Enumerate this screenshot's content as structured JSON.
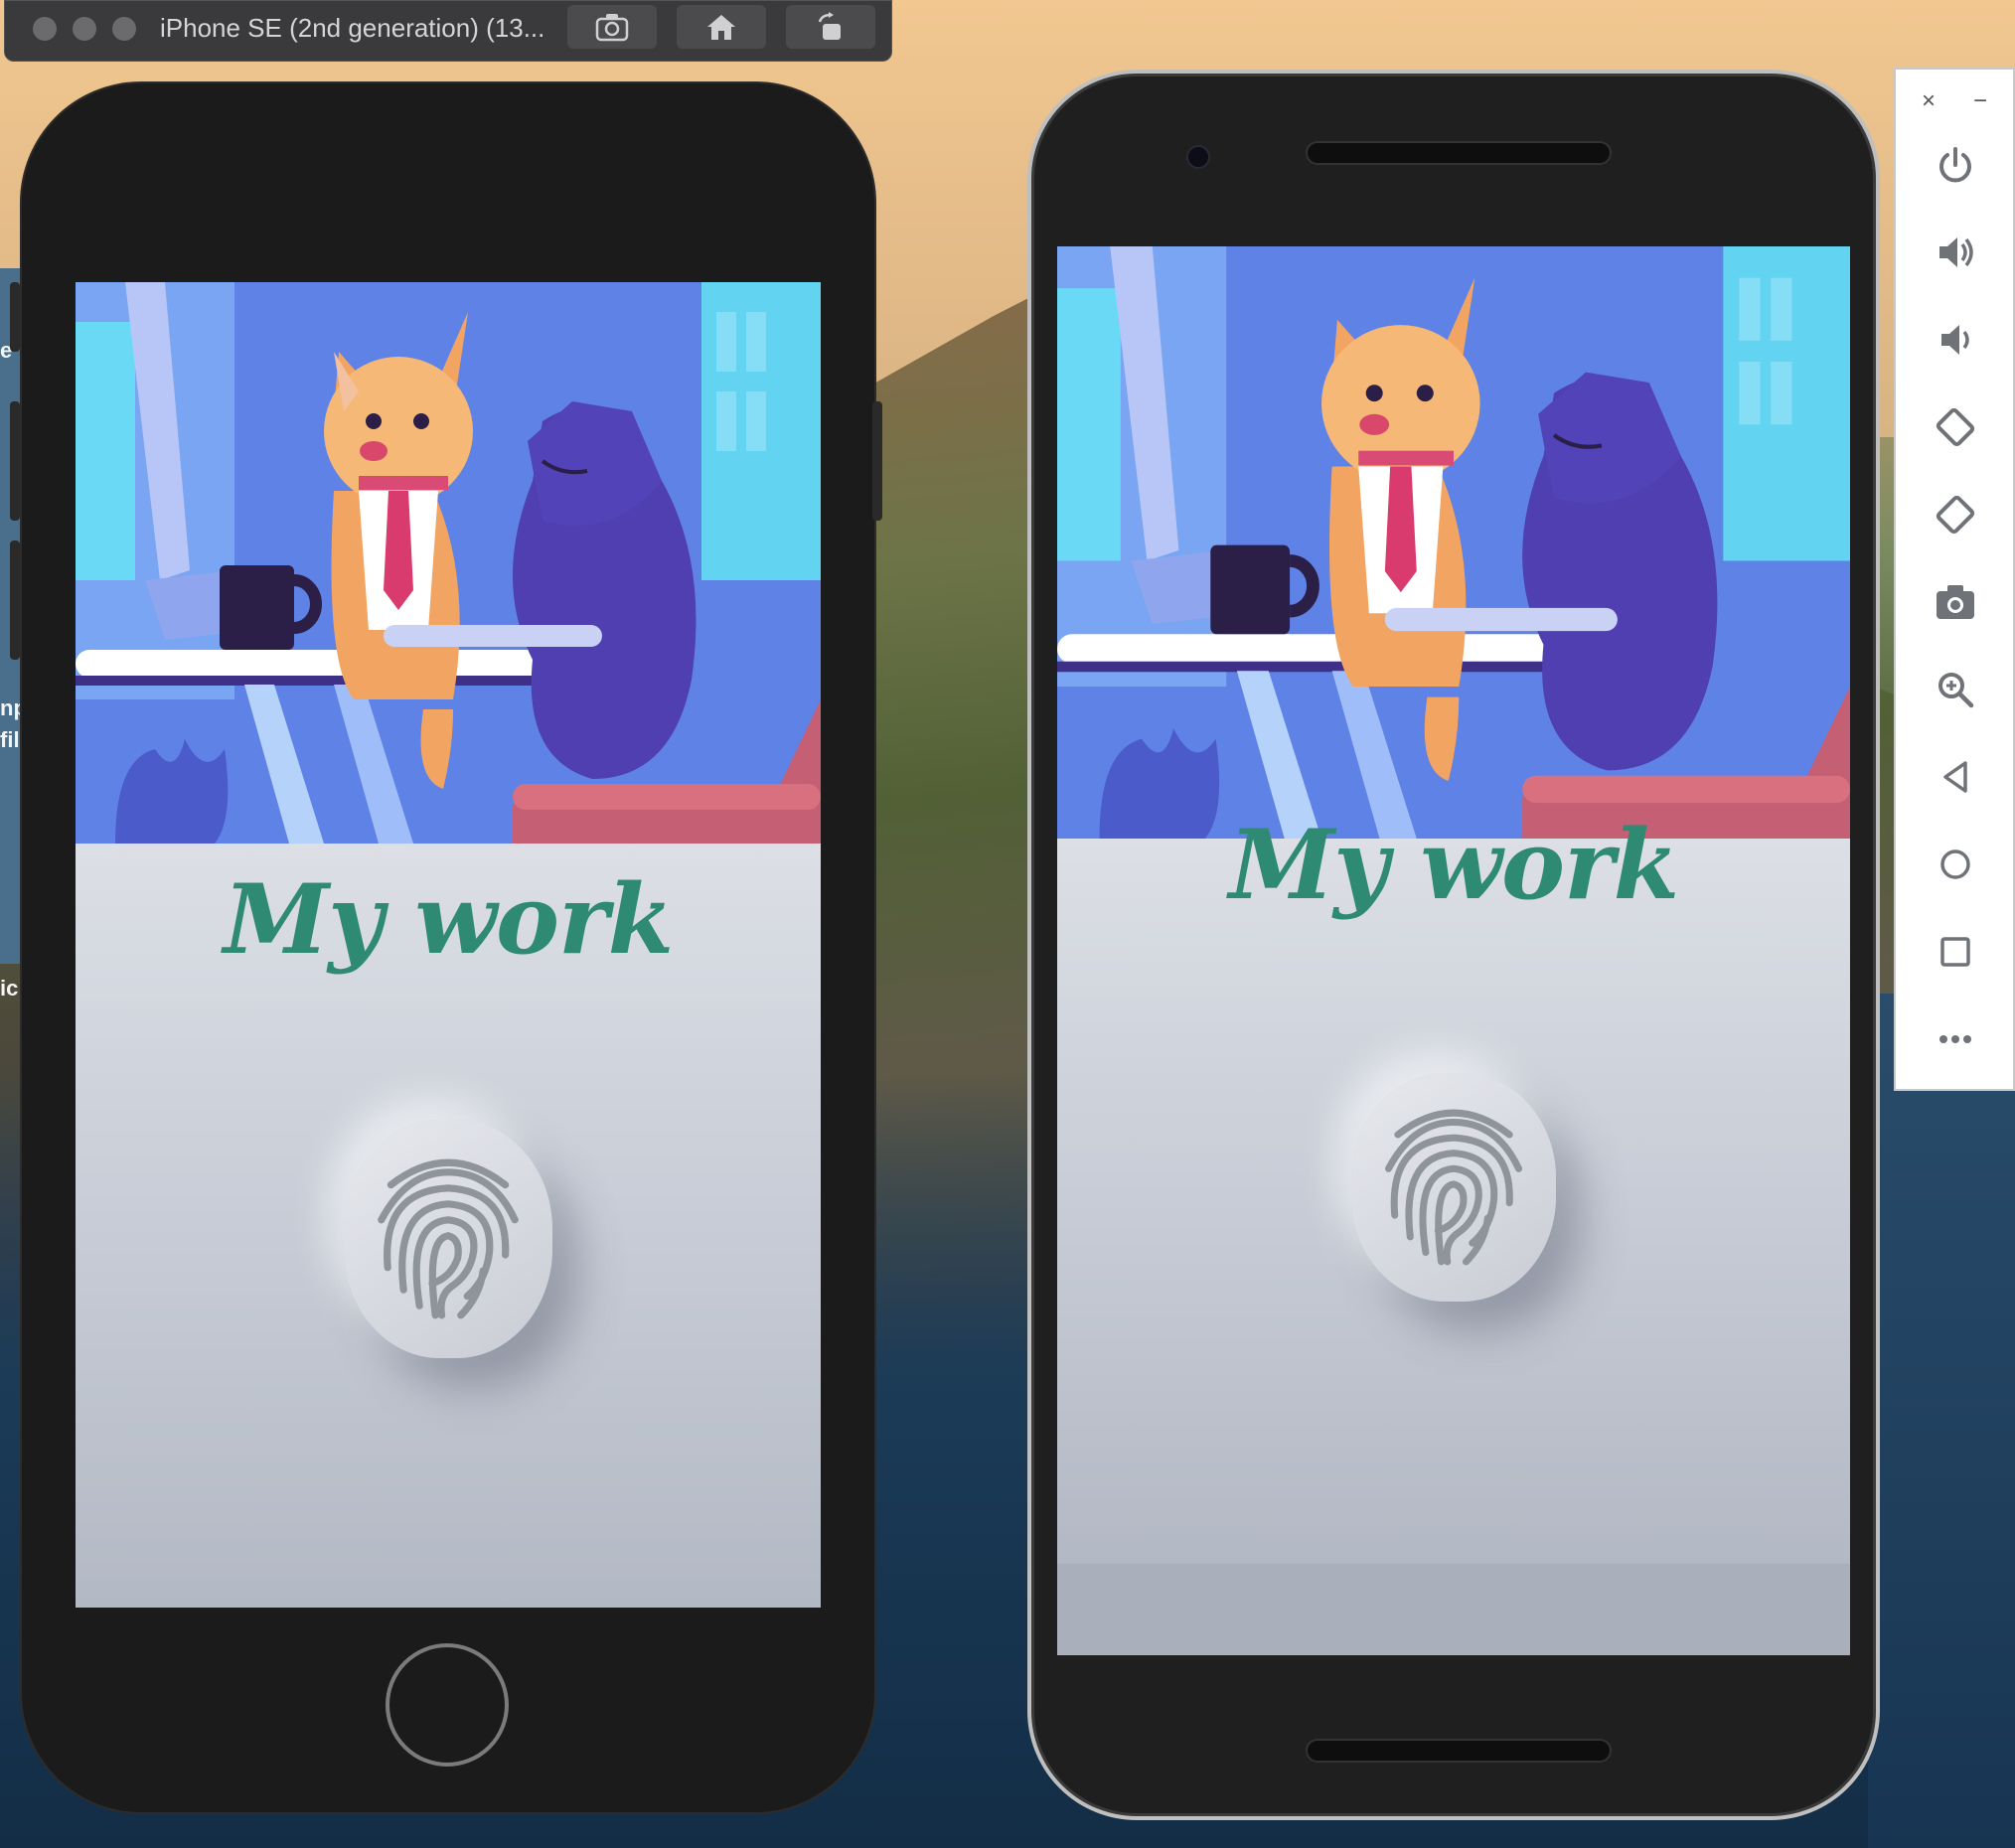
{
  "simulator": {
    "title": "iPhone SE (2nd generation) (13...",
    "toolbar": [
      "screenshot-icon",
      "home-icon",
      "rotate-icon"
    ]
  },
  "desktop": {
    "peek_texts": [
      "e",
      "np",
      "fil",
      "ic"
    ]
  },
  "app": {
    "heading": "My work",
    "fingerprint_label": "fingerprint-icon"
  },
  "emulator_sidebar": {
    "close": "×",
    "minimize": "−",
    "tools": [
      "power-icon",
      "volume-up-icon",
      "volume-down-icon",
      "rotate-left-icon",
      "rotate-right-icon",
      "camera-icon",
      "zoom-icon",
      "back-icon",
      "home-circle-icon",
      "overview-square-icon",
      "more-icon"
    ]
  },
  "colors": {
    "heading": "#2f8a73",
    "illustration_bg": "#5f82e6",
    "content_bg": "#c7ccd6"
  }
}
